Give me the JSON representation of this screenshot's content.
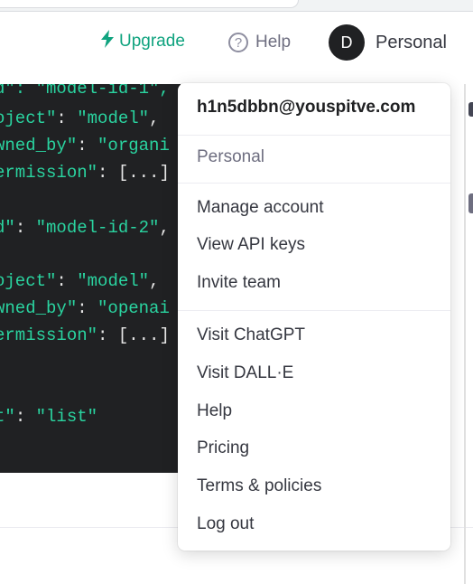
{
  "header": {
    "upgrade_label": "Upgrade",
    "help_label": "Help",
    "help_icon": "question-circle-icon",
    "avatar_initial": "D",
    "account_label": "Personal"
  },
  "code": {
    "lines": [
      {
        "key": "d\": ",
        "value": "\"model-id-1\","
      },
      {
        "key": "oject\"",
        "value": ": \"model\","
      },
      {
        "key": "wned_by\"",
        "value": ": \"organi"
      },
      {
        "key": "ermission\"",
        "value": ": [...]"
      },
      {
        "key": "d\"",
        "value": ": \"model-id-2\","
      },
      {
        "key": "oject\"",
        "value": ": \"model\","
      },
      {
        "key": "wned_by\"",
        "value": ": \"openai"
      },
      {
        "key": "ermission\"",
        "value": ": [...]"
      },
      {
        "key": "t\"",
        "value": ": \"list\""
      }
    ]
  },
  "menu": {
    "email": "h1n5dbbn@youspitve.com",
    "org": "Personal",
    "group1": [
      "Manage account",
      "View API keys",
      "Invite team"
    ],
    "group2": [
      "Visit ChatGPT",
      "Visit DALL·E",
      "Help",
      "Pricing",
      "Terms & policies",
      "Log out"
    ]
  },
  "colors": {
    "accent": "#10a37f",
    "code_bg": "#202123",
    "code_text": "#2ad4a0"
  }
}
